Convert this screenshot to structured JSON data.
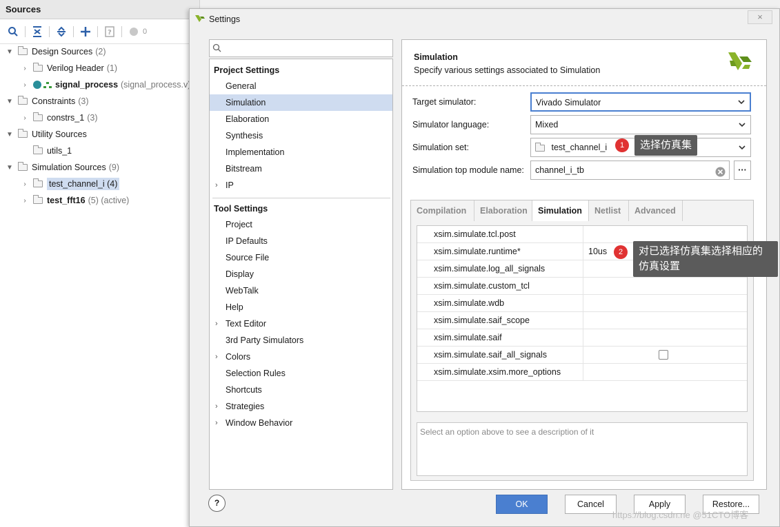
{
  "sources": {
    "title": "Sources",
    "toolbar_count": "0",
    "tree": [
      {
        "label": "Design Sources",
        "count": "(2)",
        "level": 0,
        "expanded": true
      },
      {
        "label": "Verilog Header",
        "count": "(1)",
        "level": 1
      },
      {
        "label": "signal_process",
        "count": "(signal_process.v) (",
        "level": 1,
        "bold": true
      },
      {
        "label": "Constraints",
        "count": "(3)",
        "level": 0,
        "expanded": true
      },
      {
        "label": "constrs_1",
        "count": "(3)",
        "level": 1
      },
      {
        "label": "Utility Sources",
        "count": "",
        "level": 0,
        "expanded": true
      },
      {
        "label": "utils_1",
        "count": "",
        "level": 1
      },
      {
        "label": "Simulation Sources",
        "count": "(9)",
        "level": 0,
        "expanded": true
      },
      {
        "label": "test_channel_i (4)",
        "count": "",
        "level": 1,
        "selected": true
      },
      {
        "label": "test_fft16",
        "count": "(5) (active)",
        "level": 1,
        "bold": true
      }
    ]
  },
  "dialog": {
    "title": "Settings",
    "close_icon": "×",
    "search_placeholder": "Q-",
    "project_settings_header": "Project Settings",
    "project_settings": [
      "General",
      "Simulation",
      "Elaboration",
      "Synthesis",
      "Implementation",
      "Bitstream",
      "IP"
    ],
    "tool_settings_header": "Tool Settings",
    "tool_settings": [
      "Project",
      "IP Defaults",
      "Source File",
      "Display",
      "WebTalk",
      "Help",
      "Text Editor",
      "3rd Party Simulators",
      "Colors",
      "Selection Rules",
      "Shortcuts",
      "Strategies",
      "Window Behavior"
    ],
    "section_title": "Simulation",
    "section_desc": "Specify various settings associated to Simulation",
    "target_simulator_label": "Target simulator:",
    "target_simulator_value": "Vivado Simulator",
    "simulator_language_label": "Simulator language:",
    "simulator_language_value": "Mixed",
    "simulation_set_label": "Simulation set:",
    "simulation_set_value": "test_channel_i",
    "top_module_label": "Simulation top module name:",
    "top_module_value": "channel_i_tb",
    "more_button": "···",
    "tabs": [
      "Compilation",
      "Elaboration",
      "Simulation",
      "Netlist",
      "Advanced"
    ],
    "properties": [
      {
        "name": "xsim.simulate.tcl.post",
        "value": ""
      },
      {
        "name": "xsim.simulate.runtime*",
        "value": "10us"
      },
      {
        "name": "xsim.simulate.log_all_signals",
        "value": ""
      },
      {
        "name": "xsim.simulate.custom_tcl",
        "value": ""
      },
      {
        "name": "xsim.simulate.wdb",
        "value": ""
      },
      {
        "name": "xsim.simulate.saif_scope",
        "value": ""
      },
      {
        "name": "xsim.simulate.saif",
        "value": ""
      },
      {
        "name": "xsim.simulate.saif_all_signals",
        "value": ""
      },
      {
        "name": "xsim.simulate.xsim.more_options",
        "value": ""
      }
    ],
    "description_placeholder": "Select an option above to see a description of it",
    "help_label": "?",
    "ok": "OK",
    "cancel": "Cancel",
    "apply": "Apply",
    "restore": "Restore..."
  },
  "annotations": {
    "badge1": "1",
    "callout1": "选择仿真集",
    "badge2": "2",
    "callout2": "对已选择仿真集选择相应的仿真设置"
  },
  "watermark": "https://blog.csdn.ne @51CTO博客",
  "colors": {
    "accent": "#4a7fd0",
    "selection": "#cfdcf0",
    "badge": "#e03232",
    "callout": "#5b5b5b"
  }
}
